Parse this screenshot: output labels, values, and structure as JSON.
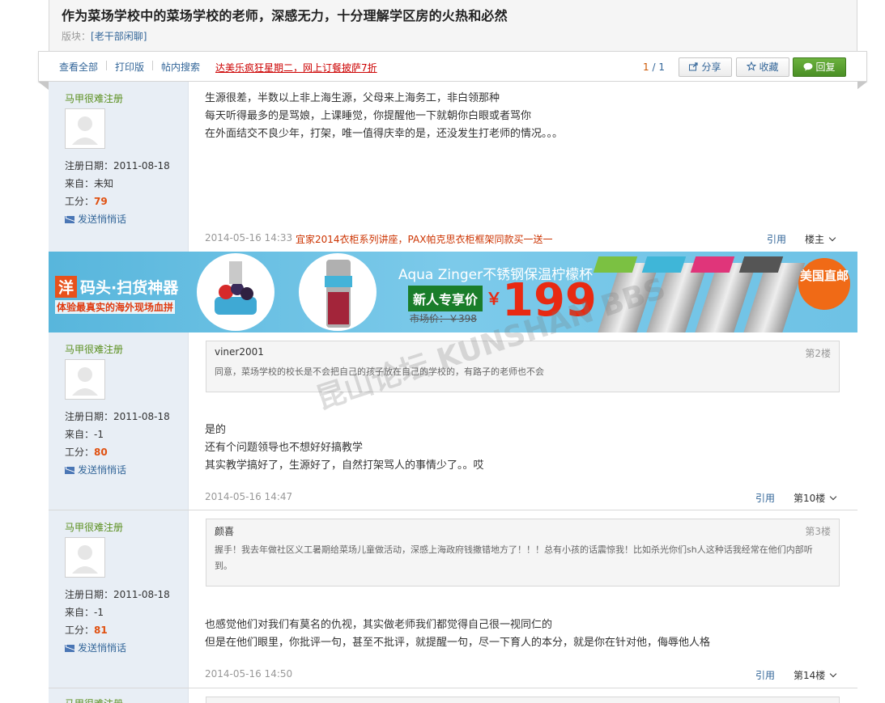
{
  "thread": {
    "title": "作为菜场学校中的菜场学校的老师，深感无力，十分理解学区房的火热和必然",
    "board_label": "版块：",
    "board_name": "[老干部闲聊]"
  },
  "toolbar": {
    "view_all": "查看全部",
    "print": "打印版",
    "search": "帖内搜索",
    "promo": "达美乐疯狂星期二，网上订餐披萨7折",
    "page_current": "1",
    "page_sep": " / ",
    "page_total": "1",
    "share": "分享",
    "fav": "收藏",
    "reply": "回复"
  },
  "labels": {
    "reg": "注册日期：",
    "from": "来自：",
    "points": "工分：",
    "send_msg": "发送悄悄话",
    "cite": "引用"
  },
  "posts": [
    {
      "user": "马甲很难注册",
      "reg_date": "2011-08-18",
      "from": "未知",
      "points": "79",
      "lines": [
        "生源很差，半数以上非上海生源，父母来上海务工，非白领那种",
        "每天听得最多的是骂娘，上课睡觉，你提醒他一下就朝你白眼或者骂你",
        "在外面结交不良少年，打架，唯一值得庆幸的是，还没发生打老师的情况。。。"
      ],
      "time": "2014-05-16 14:33",
      "ad": "宜家2014衣柜系列讲座，PAX帕克思衣柜框架同款买一送一",
      "floor": "楼主"
    },
    {
      "user": "马甲很难注册",
      "reg_date": "2011-08-18",
      "from": "-1",
      "points": "80",
      "quote_user": "viner2001",
      "quote_floor": "第2楼",
      "quote_text": "同意，菜场学校的校长是不会把自己的孩子放在自己的学校的，有路子的老师也不会",
      "lines": [
        "是的",
        "还有个问题领导也不想好好搞教学",
        "其实教学搞好了，生源好了，自然打架骂人的事情少了。。哎"
      ],
      "time": "2014-05-16 14:47",
      "floor": "第10楼"
    },
    {
      "user": "马甲很难注册",
      "reg_date": "2011-08-18",
      "from": "-1",
      "points": "81",
      "quote_user": "颜喜",
      "quote_floor": "第3楼",
      "quote_text": "握手！我去年做社区义工暑期给菜场儿童做活动，深感上海政府钱撒错地方了！！！总有小孩的话震惊我！比如杀光你们sh人这种话我经常在他们内部听到。",
      "lines": [
        "也感觉他们对我们有莫名的仇视，其实做老师我们都觉得自己很一视同仁的",
        "但是在他们眼里，你批评一句，甚至不批评，就提醒一句，尽一下育人的本分，就是你在针对他，侮辱他人格"
      ],
      "time": "2014-05-16 14:50",
      "floor": "第14楼"
    },
    {
      "user": "马甲很难注册"
    }
  ],
  "ad": {
    "brand_tag": "洋",
    "brand": "码头·扫货神器",
    "sub": "体验最真实的海外现场血拼",
    "product": "Aqua Zinger不锈钢保温柠檬杯",
    "new_price_label": "新人专享价",
    "currency": "￥",
    "price": "199",
    "market": "市场价：￥398",
    "badge": "美国直邮"
  },
  "watermark": "昆山论坛 KUNSHAN BBS",
  "colors": {
    "link": "#336699",
    "username": "#5a8f1e",
    "points": "#e05010",
    "sidebar": "#e8eef5",
    "reply_button": "#4a8f25"
  }
}
